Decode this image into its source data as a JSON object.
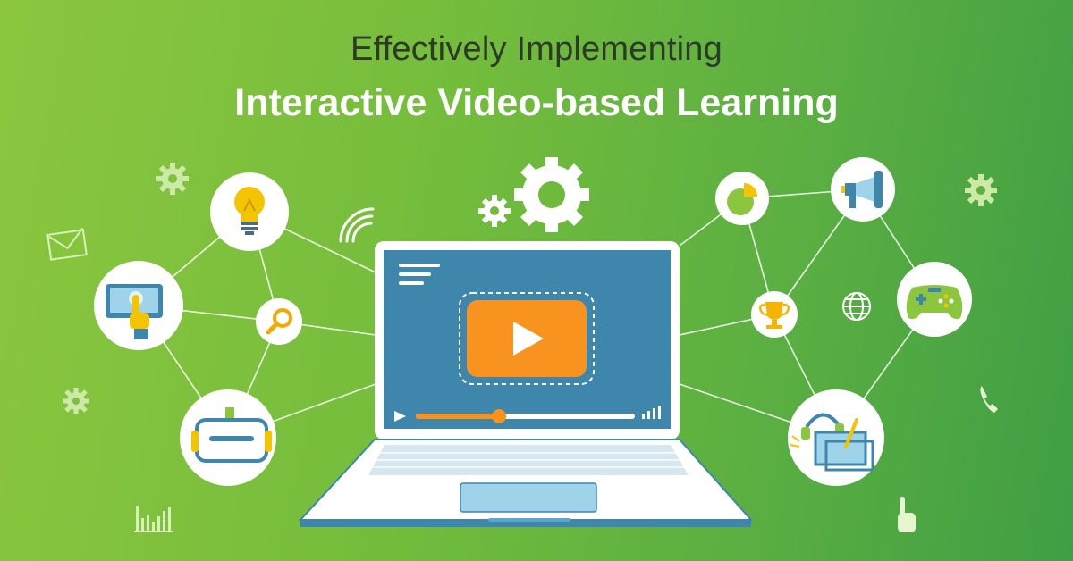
{
  "header": {
    "subtitle": "Effectively Implementing",
    "title": "Interactive Video-based Learning"
  },
  "colors": {
    "background_start": "#8cc63f",
    "background_end": "#3f9e44",
    "screen": "#3f86ad",
    "play_button": "#f7931e",
    "accent_yellow": "#f5c400",
    "circle_fill": "#ffffff"
  },
  "video_player": {
    "progress": 0.38
  },
  "icons": [
    "lightbulb-icon",
    "touch-screen-icon",
    "search-icon",
    "vr-headset-icon",
    "pie-chart-icon",
    "megaphone-icon",
    "trophy-icon",
    "gamepad-icon",
    "drawing-tablet-icon",
    "gear-icon",
    "mail-icon",
    "globe-icon",
    "phone-icon",
    "pointer-hand-icon",
    "signal-icon",
    "bar-chart-icon"
  ]
}
